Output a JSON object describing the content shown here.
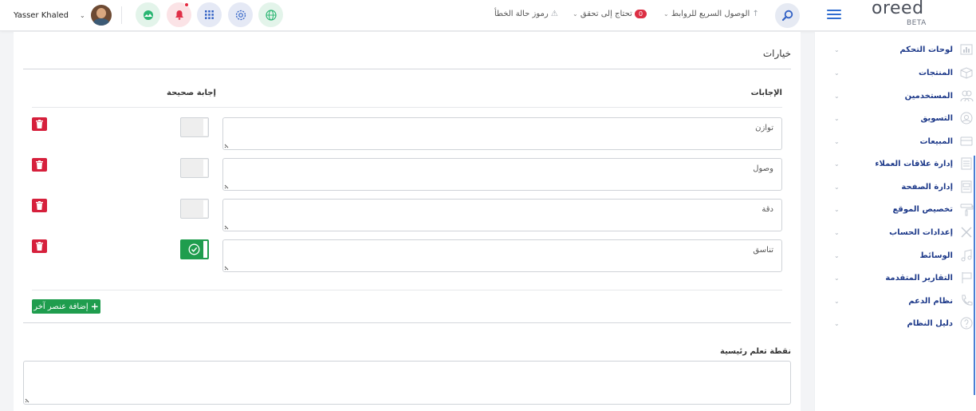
{
  "topbar": {
    "user_name": "Yasser Khaled",
    "error_codes_label": "رموز حالة الخطأ",
    "needs_check_label": "تحتاج إلى تحقق",
    "needs_check_count": "0",
    "quick_links_label": "الوصول السريع للروابط"
  },
  "logo": {
    "name": "oreed",
    "tag": "BETA"
  },
  "sidebar": {
    "items": [
      {
        "label": "لوحات التحكم",
        "icon": "dashboard-icon"
      },
      {
        "label": "المنتجات",
        "icon": "box-icon"
      },
      {
        "label": "المستخدمين",
        "icon": "users-icon"
      },
      {
        "label": "التسويق",
        "icon": "marketing-icon"
      },
      {
        "label": "المبيعات",
        "icon": "sales-icon"
      },
      {
        "label": "إدارة علاقات العملاء",
        "icon": "crm-icon"
      },
      {
        "label": "إدارة الصفحة",
        "icon": "page-icon"
      },
      {
        "label": "تخصيص الموقع",
        "icon": "paint-roller-icon"
      },
      {
        "label": "إعدادات الحساب",
        "icon": "tools-icon"
      },
      {
        "label": "الوسائط",
        "icon": "music-icon"
      },
      {
        "label": "التقارير المتقدمة",
        "icon": "flag-icon"
      },
      {
        "label": "نظام الدعم",
        "icon": "phone-icon"
      },
      {
        "label": "دليل النظام",
        "icon": "help-icon"
      }
    ]
  },
  "main": {
    "section_title": "خيارات",
    "answers_header": "الإجابات",
    "correct_header": "إجابة صحيحة",
    "answers": [
      {
        "text": "توازن",
        "correct": false
      },
      {
        "text": "وصول",
        "correct": false
      },
      {
        "text": "دقة",
        "correct": false
      },
      {
        "text": "تناسق",
        "correct": true
      }
    ],
    "add_button_label": "إضافة عنصر آخر",
    "learning_point_label": "نقطة تعلم رئيسية",
    "learning_point_value": ""
  },
  "colors": {
    "accent_blue": "#2f6dd0",
    "nav_text": "#1e3a8a",
    "success_green": "#1f9d4e",
    "danger_red": "#d6203c"
  }
}
